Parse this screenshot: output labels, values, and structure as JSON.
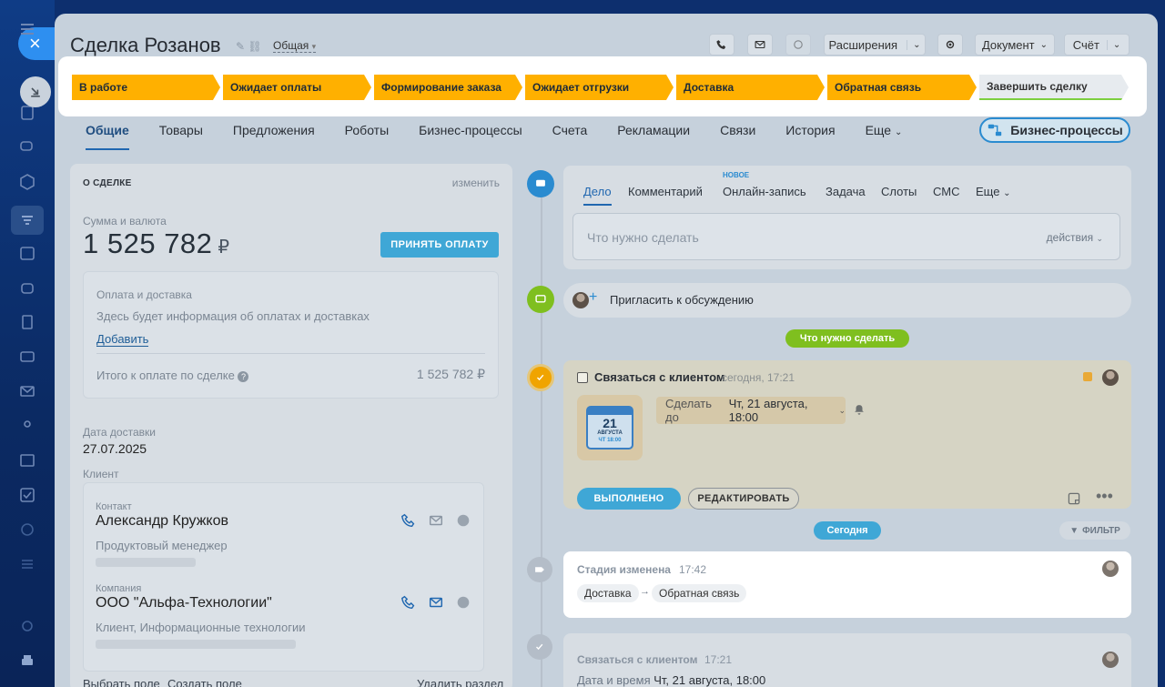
{
  "deal": {
    "title": "Сделка Розанов",
    "pipeline": "Общая"
  },
  "toolbar": {
    "extensions": "Расширения",
    "document": "Документ",
    "invoice": "Счёт"
  },
  "stages": [
    {
      "label": "В работе",
      "state": "passed"
    },
    {
      "label": "Ожидает оплаты",
      "state": "passed"
    },
    {
      "label": "Формирование заказа",
      "state": "passed"
    },
    {
      "label": "Ожидает отгрузки",
      "state": "passed"
    },
    {
      "label": "Доставка",
      "state": "passed"
    },
    {
      "label": "Обратная связь",
      "state": "current"
    },
    {
      "label": "Завершить сделку",
      "state": "final"
    }
  ],
  "tabs": [
    "Общие",
    "Товары",
    "Предложения",
    "Роботы",
    "Бизнес-процессы",
    "Счета",
    "Рекламации",
    "Связи",
    "История",
    "Еще"
  ],
  "bp_button": "Бизнес-процессы",
  "about": {
    "header": "О СДЕЛКЕ",
    "edit": "изменить",
    "amount_label": "Сумма и валюта",
    "amount": "1 525 782",
    "currency": "₽",
    "pay_button": "ПРИНЯТЬ ОПЛАТУ",
    "payment_title": "Оплата и доставка",
    "payment_info": "Здесь будет информация об оплатах и доставках",
    "add_link": "Добавить",
    "total_label": "Итого к оплате по сделке",
    "total_value": "1 525 782 ₽",
    "delivery_label": "Дата доставки",
    "delivery_value": "27.07.2025",
    "client_label": "Клиент",
    "contact_label": "Контакт",
    "contact_name": "Александр Кружков",
    "contact_position": "Продуктовый менеджер",
    "company_label": "Компания",
    "company_name": "ООО \"Альфа-Технологии\"",
    "company_desc": "Клиент, Информационные технологии",
    "select_field": "Выбрать поле",
    "create_field": "Создать поле",
    "delete_section": "Удалить раздел"
  },
  "editor": {
    "tabs": [
      "Дело",
      "Комментарий",
      "Онлайн-запись",
      "Задача",
      "Слоты",
      "СМС",
      "Еще"
    ],
    "new_badge": "НОВОЕ",
    "placeholder": "Что нужно сделать",
    "actions": "действия"
  },
  "invite": "Пригласить к обсуждению",
  "todo_pill": "Что нужно сделать",
  "task": {
    "title": "Связаться с клиентом",
    "time": "сегодня, 17:21",
    "deadline_prefix": "Сделать до",
    "deadline": "Чт, 21 августа, 18:00",
    "cal_day": "21",
    "cal_month": "АВГУСТА",
    "cal_time": "ЧТ 18:00",
    "done": "ВЫПОЛНЕНО",
    "edit": "РЕДАКТИРОВАТЬ"
  },
  "today_pill": "Сегодня",
  "filter": "ФИЛЬТР",
  "stage_change": {
    "title": "Стадия изменена",
    "time": "17:42",
    "from": "Доставка",
    "to": "Обратная связь"
  },
  "last_item": {
    "title": "Связаться с клиентом",
    "time": "17:21",
    "label": "Дата и время",
    "value": "Чт, 21 августа, 18:00"
  },
  "colors": {
    "stage_on": "#ffb000",
    "accent_blue": "#3fa7d6",
    "green": "#7fbf1f",
    "orange": "#f0a400"
  }
}
